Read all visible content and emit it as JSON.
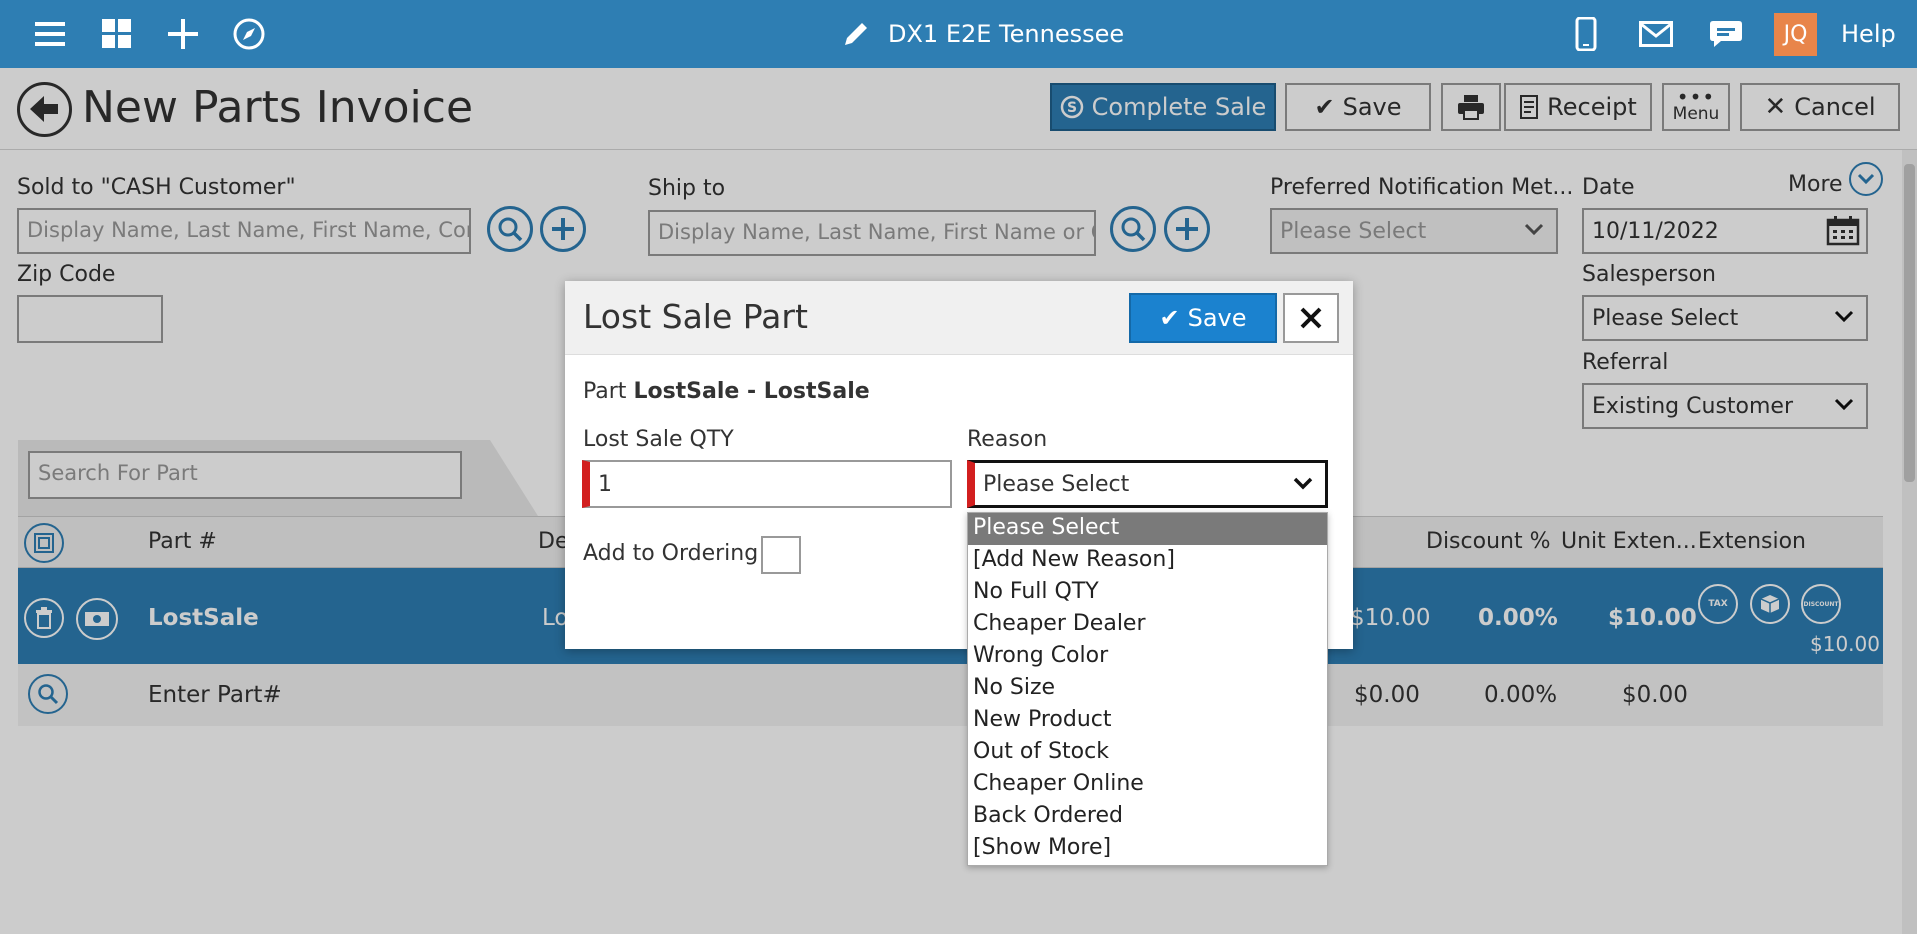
{
  "topbar": {
    "title": "DX1 E2E Tennessee",
    "avatar": "JQ",
    "help": "Help",
    "icons": [
      "hamburger-menu-icon",
      "dashboard-grid-icon",
      "plus-icon",
      "compass-icon",
      "pencil-icon",
      "mobile-phone-icon",
      "mail-icon",
      "chat-icon"
    ]
  },
  "page": {
    "title": "New Parts Invoice",
    "toolbar": {
      "complete_sale": "Complete Sale",
      "save": "Save",
      "receipt": "Receipt",
      "menu": "Menu",
      "cancel": "Cancel"
    }
  },
  "form": {
    "sold_to_label": "Sold to  \"CASH Customer\"",
    "sold_to_placeholder": "Display Name, Last Name, First Name, Comp",
    "ship_to_label": "Ship to",
    "ship_to_placeholder": "Display Name, Last Name, First Name or Co",
    "notification_label": "Preferred Notification Met...",
    "notification_value": "Please Select",
    "date_label": "Date",
    "date_value": "10/11/2022",
    "more": "More",
    "zip_label": "Zip Code",
    "salesperson_label": "Salesperson",
    "salesperson_value": "Please Select",
    "referral_label": "Referral",
    "referral_value": "Existing Customer"
  },
  "grid": {
    "search_placeholder": "Search For Part",
    "headers": {
      "part": "Part #",
      "desc": "De",
      "discount": "Discount %",
      "unit_ext": "Unit Exten...",
      "extension": "Extension"
    },
    "row1": {
      "part": "LostSale",
      "desc": "Lo",
      "price": "$10.00",
      "discount": "0.00%",
      "unit_ext": "$10.00",
      "extension": "$10.00",
      "badges": [
        "TAX",
        "DISCOUNT"
      ]
    },
    "row2": {
      "part": "Enter Part#",
      "price": "$0.00",
      "discount": "0.00%",
      "unit_ext": "$0.00"
    }
  },
  "modal": {
    "title": "Lost Sale Part",
    "save": "Save",
    "part_prefix": "Part",
    "part_name": "LostSale - LostSale",
    "qty_label": "Lost Sale QTY",
    "qty_value": "1",
    "reason_label": "Reason",
    "reason_value": "Please Select",
    "ordering_label": "Add to Ordering",
    "reason_options": [
      "Please Select",
      "[Add New Reason]",
      "No Full QTY",
      "Cheaper Dealer",
      "Wrong Color",
      "No Size",
      "New Product",
      "Out of Stock",
      "Cheaper Online",
      "Back Ordered",
      "[Show More]"
    ]
  },
  "colors": {
    "brand": "#2e7eb3",
    "save_blue": "#1b82cf",
    "required": "#d21f1f",
    "avatar": "#e8854a"
  }
}
